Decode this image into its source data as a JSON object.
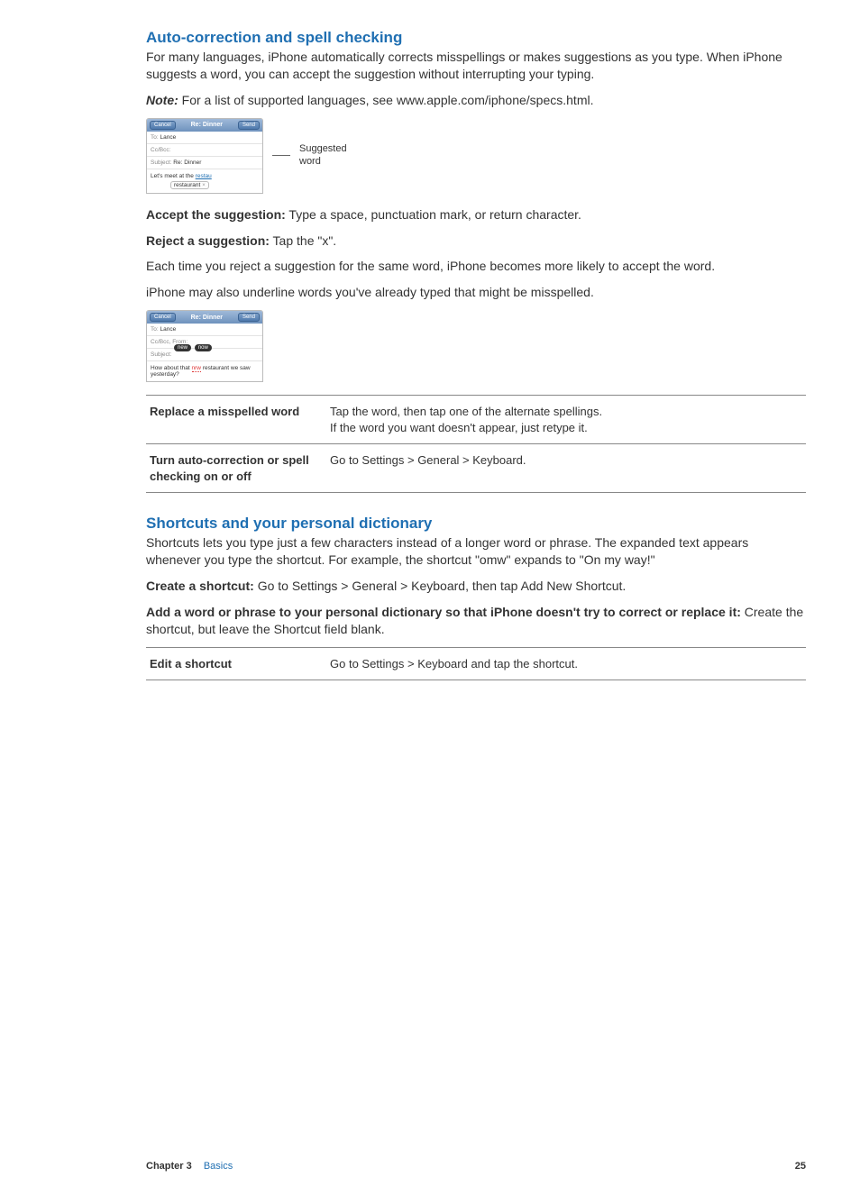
{
  "section1": {
    "title": "Auto-correction and spell checking",
    "para1": "For many languages, iPhone automatically corrects misspellings or makes suggestions as you type. When iPhone suggests a word, you can accept the suggestion without interrupting your typing.",
    "note_label": "Note:",
    "note_body": "  For a list of supported languages, see www.apple.com/iphone/specs.html.",
    "compose1": {
      "cancel": "Cancel",
      "title": "Re: Dinner",
      "send": "Send",
      "to_label": "To:",
      "to_value": "  Lance",
      "ccbcc": "Cc/Bcc:",
      "subject_label": "Subject:",
      "subject_value": " Re: Dinner",
      "body_pre": "Let's meet at the ",
      "body_typed": "restau",
      "suggestion": "restaurant",
      "x": "×"
    },
    "callout1a": "Suggested",
    "callout1b": "word",
    "accept_label": "Accept the suggestion:",
    "accept_body": "  Type a space, punctuation mark, or return character.",
    "reject_label": "Reject a suggestion:",
    "reject_body": "  Tap the \"x\".",
    "para2": "Each time you reject a suggestion for the same word, iPhone becomes more likely to accept the word.",
    "para3": "iPhone may also underline words you've already typed that might be misspelled.",
    "compose2": {
      "cancel": "Cancel",
      "title": "Re: Dinner",
      "send": "Send",
      "to_label": "To:",
      "to_value": "  Lance",
      "ccbcc": "Cc/Bcc, From:",
      "subject_label": "Subject:",
      "pill1": "new",
      "pill2": "now",
      "body_pre": "How about that ",
      "body_flag": "nrw",
      "body_post": " restaurant we saw yesterday?"
    },
    "table": {
      "r1_left": "Replace a misspelled word",
      "r1_right_l1": "Tap the word, then tap one of the alternate spellings.",
      "r1_right_l2": "If the word you want doesn't appear, just retype it.",
      "r2_left": "Turn auto-correction or spell checking on or off",
      "r2_right": "Go to Settings > General > Keyboard."
    }
  },
  "section2": {
    "title": "Shortcuts and your personal dictionary",
    "para1": "Shortcuts lets you type just a few characters instead of a longer word or phrase. The expanded text appears whenever you type the shortcut. For example, the shortcut \"omw\" expands to \"On my way!\"",
    "create_label": "Create a shortcut:",
    "create_body": "  Go to Settings > General > Keyboard, then tap Add New Shortcut.",
    "add_label": "Add a word or phrase to your personal dictionary so that iPhone doesn't try to correct or replace it:",
    "add_body": "  Create the shortcut, but leave the Shortcut field blank.",
    "table": {
      "r1_left": "Edit a shortcut",
      "r1_right": "Go to Settings > Keyboard and tap the shortcut."
    }
  },
  "footer": {
    "chapter": "Chapter 3",
    "section": "Basics",
    "page": "25"
  }
}
